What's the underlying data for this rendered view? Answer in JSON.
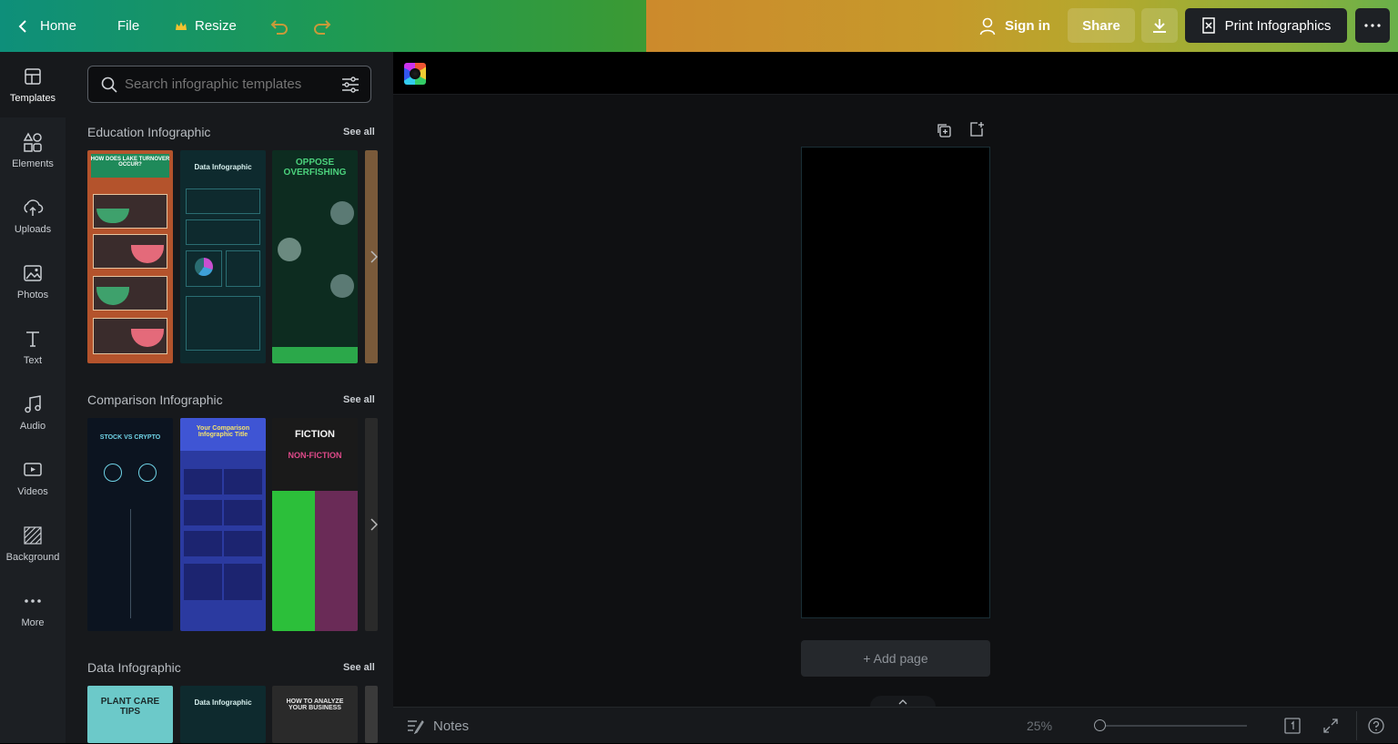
{
  "topbar": {
    "home_label": "Home",
    "file_label": "File",
    "resize_label": "Resize",
    "signin_label": "Sign in",
    "share_label": "Share",
    "print_label": "Print Infographics",
    "colors": {
      "print_bg": "#1e2125",
      "share_bg": "rgba(255,255,255,0.15)"
    }
  },
  "rail": {
    "items": [
      {
        "label": "Templates",
        "icon": "templates-icon"
      },
      {
        "label": "Elements",
        "icon": "elements-icon"
      },
      {
        "label": "Uploads",
        "icon": "upload-icon"
      },
      {
        "label": "Photos",
        "icon": "photos-icon"
      },
      {
        "label": "Text",
        "icon": "text-icon"
      },
      {
        "label": "Audio",
        "icon": "audio-icon"
      },
      {
        "label": "Videos",
        "icon": "video-icon"
      },
      {
        "label": "Background",
        "icon": "background-icon"
      },
      {
        "label": "More",
        "icon": "more-icon"
      }
    ]
  },
  "panel": {
    "search_placeholder": "Search infographic templates",
    "sections": [
      {
        "title": "Education Infographic",
        "see_all": "See all",
        "templates": [
          {
            "heading": "HOW DOES LAKE TURNOVER OCCUR?"
          },
          {
            "heading": "Data Infographic"
          },
          {
            "heading": "OPPOSE OVERFISHING"
          }
        ]
      },
      {
        "title": "Comparison Infographic",
        "see_all": "See all",
        "templates": [
          {
            "heading": "STOCK VS CRYPTO"
          },
          {
            "heading": "Your Comparison Infographic Title"
          },
          {
            "heading": "FICTION",
            "subheading": "NON-FICTION"
          }
        ]
      },
      {
        "title": "Data Infographic",
        "see_all": "See all",
        "templates": [
          {
            "heading": "PLANT CARE TIPS"
          },
          {
            "heading": "Data Infographic"
          },
          {
            "heading": "HOW TO ANALYZE YOUR BUSINESS"
          }
        ]
      }
    ]
  },
  "canvas": {
    "add_page_label": "+ Add page"
  },
  "bottombar": {
    "notes_label": "Notes",
    "zoom_label": "25%",
    "zoom_level_fraction": 0.0
  }
}
